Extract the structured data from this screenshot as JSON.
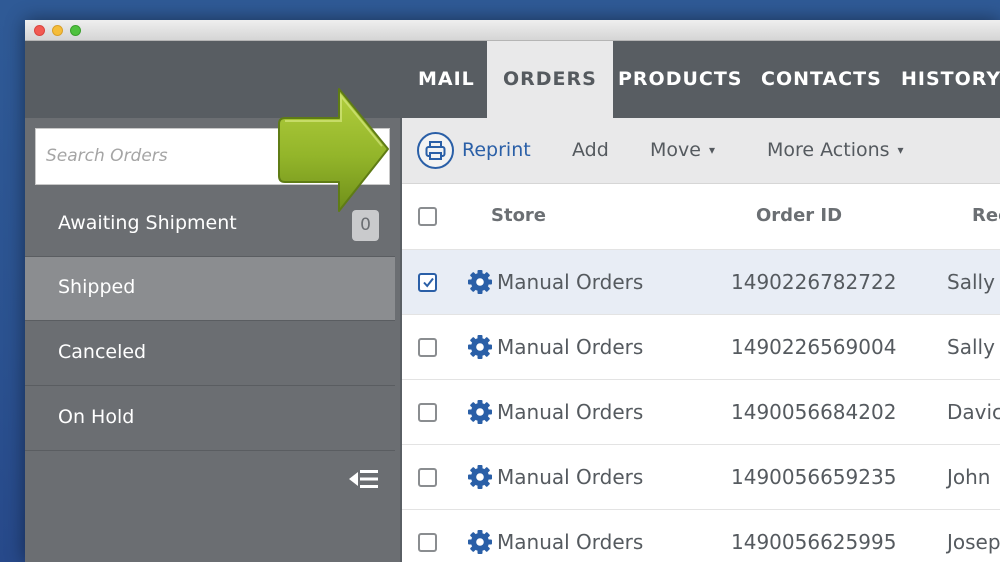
{
  "nav": {
    "tabs": [
      {
        "label": "MAIL"
      },
      {
        "label": "ORDERS"
      },
      {
        "label": "PRODUCTS"
      },
      {
        "label": "CONTACTS"
      },
      {
        "label": "HISTORY"
      }
    ],
    "active_tab": "ORDERS"
  },
  "sidebar": {
    "search_placeholder": "Search Orders",
    "items": [
      {
        "label": "Awaiting Shipment",
        "count": "0"
      },
      {
        "label": "Shipped"
      },
      {
        "label": "Canceled"
      },
      {
        "label": "On Hold"
      }
    ],
    "active_item": "Shipped",
    "collapse_icon": "collapse-sidebar-icon"
  },
  "toolbar": {
    "reprint": "Reprint",
    "add": "Add",
    "move": "Move",
    "more_actions": "More Actions"
  },
  "table": {
    "columns": [
      "Store",
      "Order ID",
      "Recip"
    ],
    "rows": [
      {
        "store": "Manual Orders",
        "order_id": "1490226782722",
        "recipient": "Sally",
        "checked": true
      },
      {
        "store": "Manual Orders",
        "order_id": "1490226569004",
        "recipient": "Sally",
        "checked": false
      },
      {
        "store": "Manual Orders",
        "order_id": "1490056684202",
        "recipient": "Davic",
        "checked": false
      },
      {
        "store": "Manual Orders",
        "order_id": "1490056659235",
        "recipient": "John",
        "checked": false
      },
      {
        "store": "Manual Orders",
        "order_id": "1490056625995",
        "recipient": "Josep",
        "checked": false
      }
    ]
  },
  "colors": {
    "accent_blue": "#2a5fa7",
    "arrow_green": "#8fb12a",
    "nav_bg": "#585d62",
    "sidebar_bg": "#6b6e72",
    "selected_row": "#e8edf5"
  },
  "icons": {
    "printer": "printer-icon",
    "gear": "gear-icon",
    "chevron": "chevron-down-icon",
    "arrow": "pointer-arrow"
  }
}
